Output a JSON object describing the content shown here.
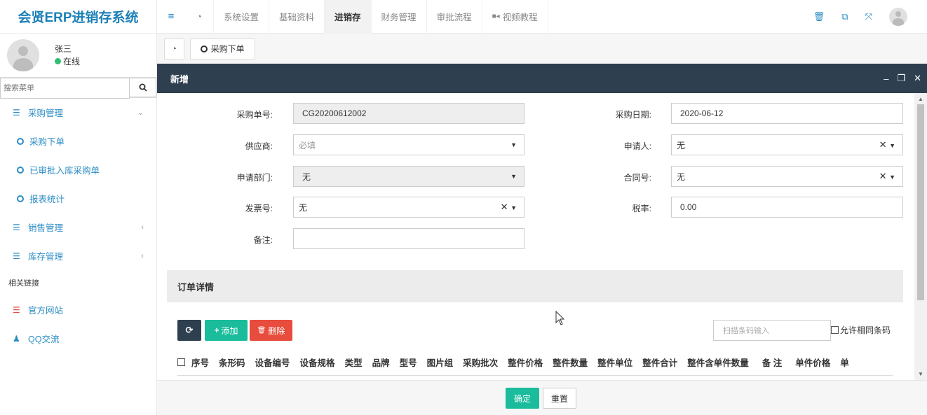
{
  "brand": "会贤ERP进销存系统",
  "user": {
    "name": "张三",
    "status": "在线"
  },
  "search": {
    "placeholder": "搜索菜单"
  },
  "sidebar": {
    "purchase": {
      "label": "采购管理",
      "children": [
        "采购下单",
        "已审批入库采购单",
        "报表统计"
      ]
    },
    "sales": {
      "label": "销售管理"
    },
    "stock": {
      "label": "库存管理"
    },
    "links_header": "相关链接",
    "official": "官方网站",
    "qq": "QQ交流"
  },
  "topnav": {
    "tabs": [
      "系统设置",
      "基础资料",
      "进销存",
      "财务管理",
      "审批流程",
      "视频教程"
    ],
    "active": "进销存"
  },
  "page_tab": "采购下单",
  "modal": {
    "title": "新增",
    "fields": {
      "order_no_label": "采购单号:",
      "order_no": "CG20200612002",
      "date_label": "采购日期:",
      "date": "2020-06-12",
      "supplier_label": "供应商:",
      "supplier_placeholder": "必填",
      "applicant_label": "申请人:",
      "applicant": "无",
      "dept_label": "申请部门:",
      "dept": "无",
      "contract_label": "合同号:",
      "contract": "无",
      "invoice_label": "发票号:",
      "invoice": "无",
      "tax_label": "税率:",
      "tax": "0.00",
      "remark_label": "备注:"
    },
    "section_title": "订单详情",
    "buttons": {
      "add": "添加",
      "delete": "删除"
    },
    "scan_placeholder": "扫描条码输入",
    "allow_same": "允许相同条码",
    "columns": [
      "序号",
      "条形码",
      "设备编号",
      "设备规格",
      "类型",
      "品牌",
      "型号",
      "图片组",
      "采购批次",
      "整件价格",
      "整件数量",
      "整件单位",
      "整件合计",
      "整件含单件数量",
      "备 注",
      "单件价格",
      "单"
    ]
  },
  "footer": {
    "ok": "确定",
    "reset": "重置"
  }
}
